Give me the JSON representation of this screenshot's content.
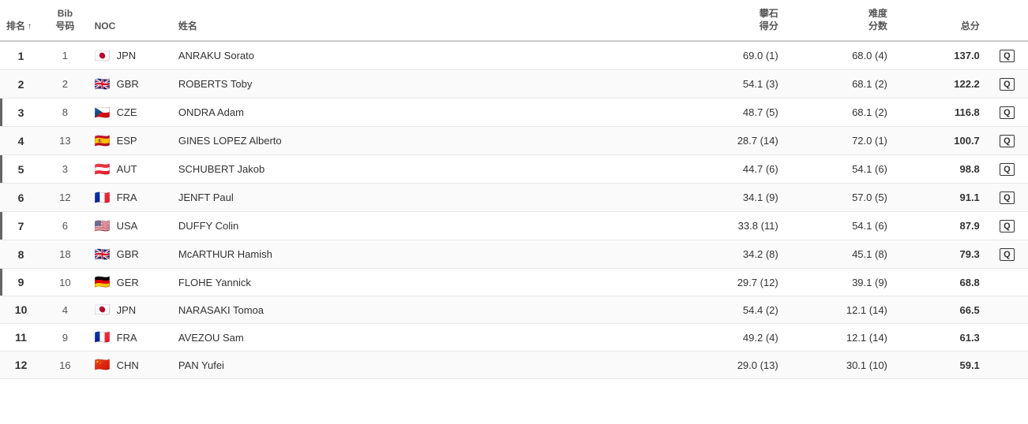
{
  "headers": {
    "rank": "排名",
    "bib": "Bib\n号码",
    "noc": "NOC",
    "name": "姓名",
    "boulder_score": "攀石\n得分",
    "difficulty_score": "难度\n分数",
    "total": "总分"
  },
  "rows": [
    {
      "rank": 1,
      "bib": 1,
      "flag": "🇯🇵",
      "noc": "JPN",
      "name": "ANRAKU Sorato",
      "boulder": "69.0 (1)",
      "difficulty": "68.0 (4)",
      "total": "137.0",
      "qualified": true,
      "bar": false
    },
    {
      "rank": 2,
      "bib": 2,
      "flag": "🇬🇧",
      "noc": "GBR",
      "name": "ROBERTS Toby",
      "boulder": "54.1 (3)",
      "difficulty": "68.1 (2)",
      "total": "122.2",
      "qualified": true,
      "bar": false
    },
    {
      "rank": 3,
      "bib": 8,
      "flag": "🇨🇿",
      "noc": "CZE",
      "name": "ONDRA Adam",
      "boulder": "48.7 (5)",
      "difficulty": "68.1 (2)",
      "total": "116.8",
      "qualified": true,
      "bar": true
    },
    {
      "rank": 4,
      "bib": 13,
      "flag": "🇪🇸",
      "noc": "ESP",
      "name": "GINES LOPEZ Alberto",
      "boulder": "28.7 (14)",
      "difficulty": "72.0 (1)",
      "total": "100.7",
      "qualified": true,
      "bar": false
    },
    {
      "rank": 5,
      "bib": 3,
      "flag": "🇦🇹",
      "noc": "AUT",
      "name": "SCHUBERT Jakob",
      "boulder": "44.7 (6)",
      "difficulty": "54.1 (6)",
      "total": "98.8",
      "qualified": true,
      "bar": true
    },
    {
      "rank": 6,
      "bib": 12,
      "flag": "🇫🇷",
      "noc": "FRA",
      "name": "JENFT Paul",
      "boulder": "34.1 (9)",
      "difficulty": "57.0 (5)",
      "total": "91.1",
      "qualified": true,
      "bar": false
    },
    {
      "rank": 7,
      "bib": 6,
      "flag": "🇺🇸",
      "noc": "USA",
      "name": "DUFFY Colin",
      "boulder": "33.8 (11)",
      "difficulty": "54.1 (6)",
      "total": "87.9",
      "qualified": true,
      "bar": true
    },
    {
      "rank": 8,
      "bib": 18,
      "flag": "🇬🇧",
      "noc": "GBR",
      "name": "McARTHUR Hamish",
      "boulder": "34.2 (8)",
      "difficulty": "45.1 (8)",
      "total": "79.3",
      "qualified": true,
      "bar": false
    },
    {
      "rank": 9,
      "bib": 10,
      "flag": "🇩🇪",
      "noc": "GER",
      "name": "FLOHE Yannick",
      "boulder": "29.7 (12)",
      "difficulty": "39.1 (9)",
      "total": "68.8",
      "qualified": false,
      "bar": true
    },
    {
      "rank": 10,
      "bib": 4,
      "flag": "🇯🇵",
      "noc": "JPN",
      "name": "NARASAKI Tomoa",
      "boulder": "54.4 (2)",
      "difficulty": "12.1 (14)",
      "total": "66.5",
      "qualified": false,
      "bar": false
    },
    {
      "rank": 11,
      "bib": 9,
      "flag": "🇫🇷",
      "noc": "FRA",
      "name": "AVEZOU Sam",
      "boulder": "49.2 (4)",
      "difficulty": "12.1 (14)",
      "total": "61.3",
      "qualified": false,
      "bar": false
    },
    {
      "rank": 12,
      "bib": 16,
      "flag": "🇨🇳",
      "noc": "CHN",
      "name": "PAN Yufei",
      "boulder": "29.0 (13)",
      "difficulty": "30.1 (10)",
      "total": "59.1",
      "qualified": false,
      "bar": false
    }
  ]
}
